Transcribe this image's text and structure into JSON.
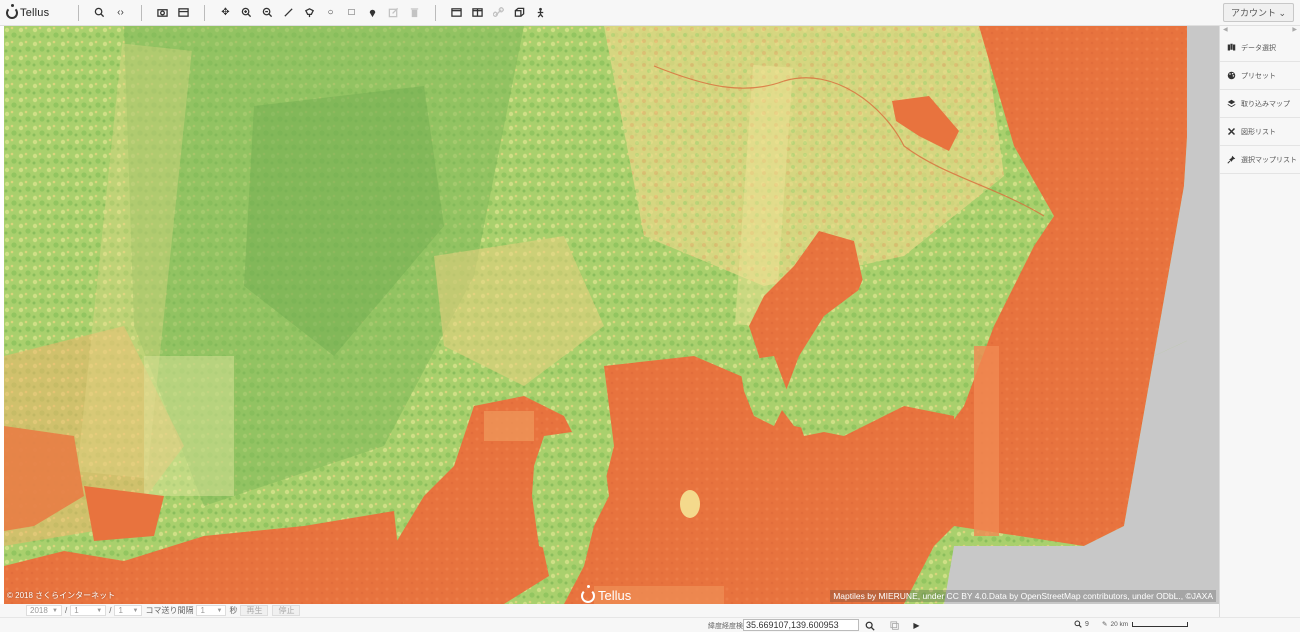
{
  "app": {
    "logo_text": "Tellus"
  },
  "toolbar": {
    "groups": [
      [
        {
          "name": "search-icon",
          "glyph": "search"
        },
        {
          "name": "share-code-icon",
          "glyph": "‹›"
        }
      ],
      [
        {
          "name": "camera-icon",
          "glyph": "camera"
        },
        {
          "name": "layers-panel-icon",
          "glyph": "panel"
        }
      ],
      [
        {
          "name": "pan-icon",
          "glyph": "✥"
        },
        {
          "name": "zoom-in-icon",
          "glyph": "zoomin"
        },
        {
          "name": "zoom-out-icon",
          "glyph": "zoomout"
        },
        {
          "name": "draw-line-icon",
          "glyph": "line"
        },
        {
          "name": "draw-polygon-icon",
          "glyph": "poly"
        },
        {
          "name": "draw-circle-icon",
          "glyph": "○"
        },
        {
          "name": "draw-rectangle-icon",
          "glyph": "□"
        },
        {
          "name": "place-marker-icon",
          "glyph": "pin"
        },
        {
          "name": "edit-shape-icon",
          "glyph": "edit",
          "disabled": true
        },
        {
          "name": "delete-shape-icon",
          "glyph": "trash",
          "disabled": true
        }
      ],
      [
        {
          "name": "single-view-icon",
          "glyph": "win"
        },
        {
          "name": "split-view-icon",
          "glyph": "split"
        },
        {
          "name": "link-views-icon",
          "glyph": "link",
          "disabled": true
        },
        {
          "name": "3d-view-icon",
          "glyph": "cube"
        },
        {
          "name": "elevation-profile-icon",
          "glyph": "person"
        }
      ]
    ],
    "account_label": "アカウント ⌄"
  },
  "map": {
    "attribution_left": "© 2018 さくらインターネット",
    "attribution_right": "Maptiles by MIERUNE, under CC BY 4.0.Data by OpenStreetMap contributors, under ODbL., ©JAXA",
    "watermark_text": "Tellus",
    "colors": {
      "land_green": "#a8cf6c",
      "land_dark": "#7fb85a",
      "land_yellow": "#e6e08a",
      "water_orange": "#e9743f",
      "water_light": "#f08a52",
      "nodata": "#c8c8c8"
    }
  },
  "panel": {
    "items": [
      {
        "name": "data-select",
        "icon": "map-icon",
        "label": "データ選択"
      },
      {
        "name": "preset",
        "icon": "palette-icon",
        "label": "プリセット"
      },
      {
        "name": "imported-maps",
        "icon": "layers-icon",
        "label": "取り込みマップ"
      },
      {
        "name": "shape-list",
        "icon": "tools-icon",
        "label": "図形リスト"
      },
      {
        "name": "selected-map-list",
        "icon": "pin-list-icon",
        "label": "選択マップリスト"
      }
    ]
  },
  "timebar": {
    "year": "2018",
    "month": "1",
    "day": "1",
    "interval_label": "コマ送り間隔",
    "interval": "1",
    "unit": "秒",
    "play_label": "再生",
    "stop_label": "停止"
  },
  "status": {
    "coord_label": "緯度経度検索",
    "coord_value": "35.669107,139.600953",
    "zoom_label": "9",
    "scale_label": "20 km"
  }
}
